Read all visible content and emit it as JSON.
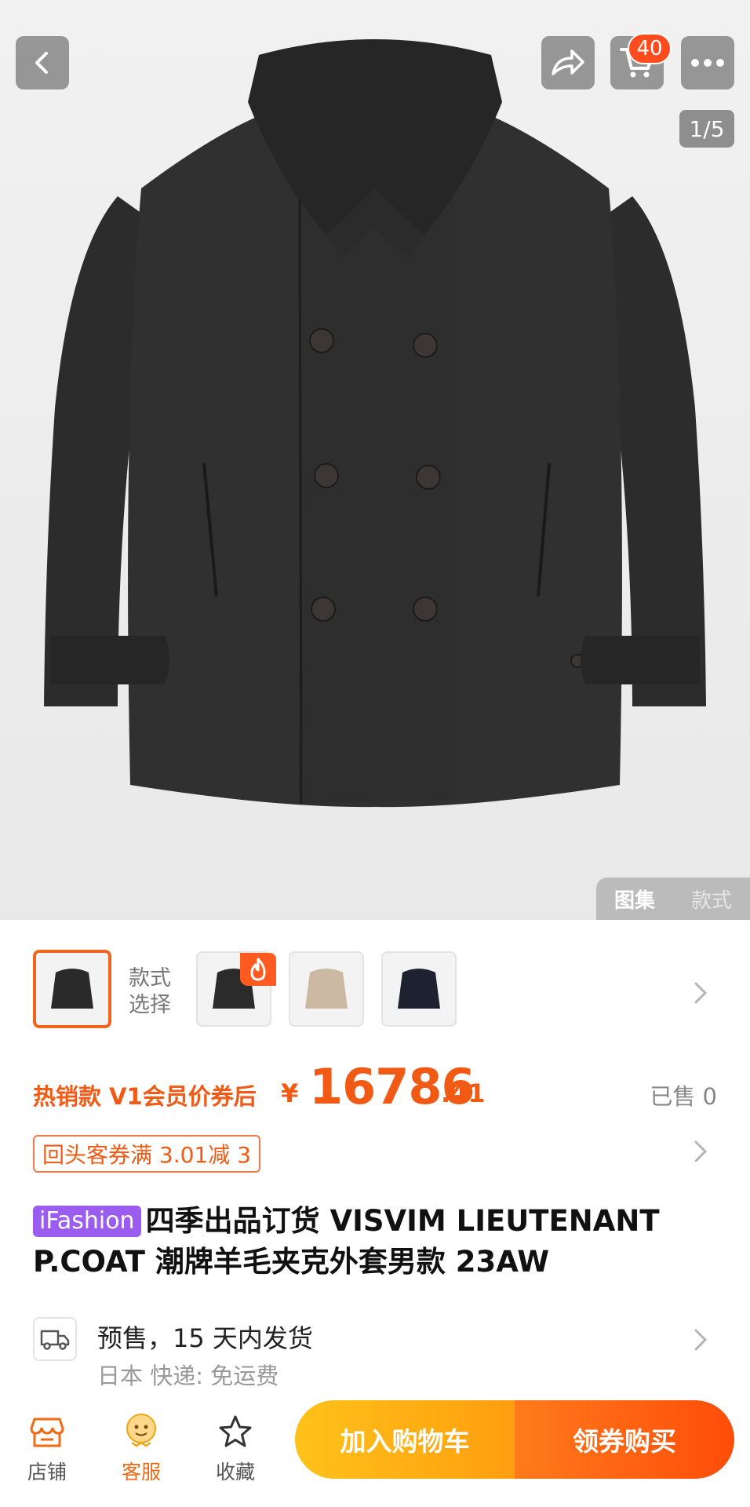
{
  "header": {
    "back_icon": "chevron-left-icon",
    "share_icon": "share-arrow-icon",
    "cart_icon": "cart-icon",
    "more_icon": "more-dots-icon",
    "cart_count": "40",
    "image_index": "1/5"
  },
  "gallery": {
    "tabs": [
      {
        "label": "图集",
        "active": true
      },
      {
        "label": "款式",
        "active": false
      }
    ]
  },
  "variants": {
    "label_line1": "款式",
    "label_line2": "选择",
    "hot_icon": "flame-icon",
    "items": [
      {
        "color": "#2a2a2a",
        "selected": true
      },
      {
        "color": "#2b2b2b",
        "selected": false,
        "hot": true
      },
      {
        "color": "#cbb9a3",
        "selected": false
      },
      {
        "color": "#1e2230",
        "selected": false
      }
    ]
  },
  "price": {
    "promo_label": "热销款 V1会员价券后",
    "currency": "¥",
    "integer": "16786",
    "decimal": ".41",
    "sold": "已售 0",
    "accent_color": "#f05a14"
  },
  "coupon": {
    "text": "回头客券满 3.01减 3"
  },
  "product": {
    "brand_badge": "iFashion",
    "title": "四季出品订货 VISVIM LIEUTENANT P.COAT 潮牌羊毛夹克外套男款 23AW"
  },
  "shipping": {
    "icon": "delivery-truck-icon",
    "main": "预售，15 天内发货",
    "sub": "日本  快递: 免运费"
  },
  "bottom_nav": {
    "items": [
      {
        "label": "店铺",
        "icon": "store-icon"
      },
      {
        "label": "客服",
        "icon": "customer-service-icon"
      },
      {
        "label": "收藏",
        "icon": "star-icon"
      }
    ],
    "add_to_cart": "加入购物车",
    "buy_now": "领券购买"
  }
}
